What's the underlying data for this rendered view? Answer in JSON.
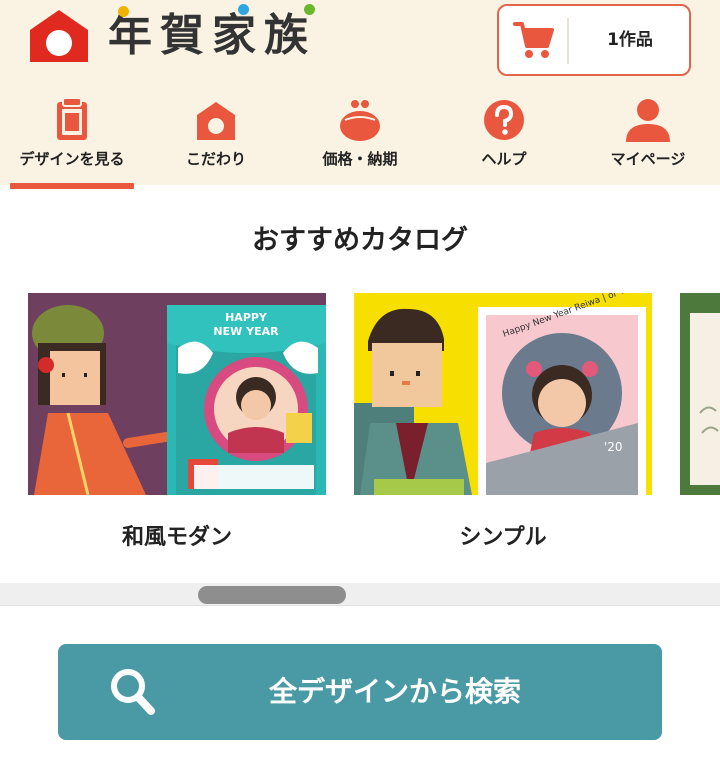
{
  "header": {
    "logo_text": "年賀家族",
    "cart_count": "1作品"
  },
  "nav": {
    "items": [
      {
        "label": "デザインを見る",
        "icon": "clipboard-icon",
        "active": true
      },
      {
        "label": "こだわり",
        "icon": "house-icon"
      },
      {
        "label": "価格・納期",
        "icon": "coin-purse-icon"
      },
      {
        "label": "ヘルプ",
        "icon": "question-icon"
      },
      {
        "label": "マイページ",
        "icon": "person-icon"
      }
    ]
  },
  "catalog": {
    "title": "おすすめカタログ",
    "cards": [
      {
        "label": "和風モダン",
        "image_text_1": "HAPPY",
        "image_text_2": "NEW YEAR"
      },
      {
        "label": "シンプル",
        "image_text_1": "Happy New Year  Reiwa | or Year of the |",
        "image_text_2": "'20"
      }
    ]
  },
  "search": {
    "label": "全デザインから検索"
  },
  "colors": {
    "header_bg": "#faf3e3",
    "accent": "#e8573e",
    "search_bg": "#4a9aa5"
  }
}
